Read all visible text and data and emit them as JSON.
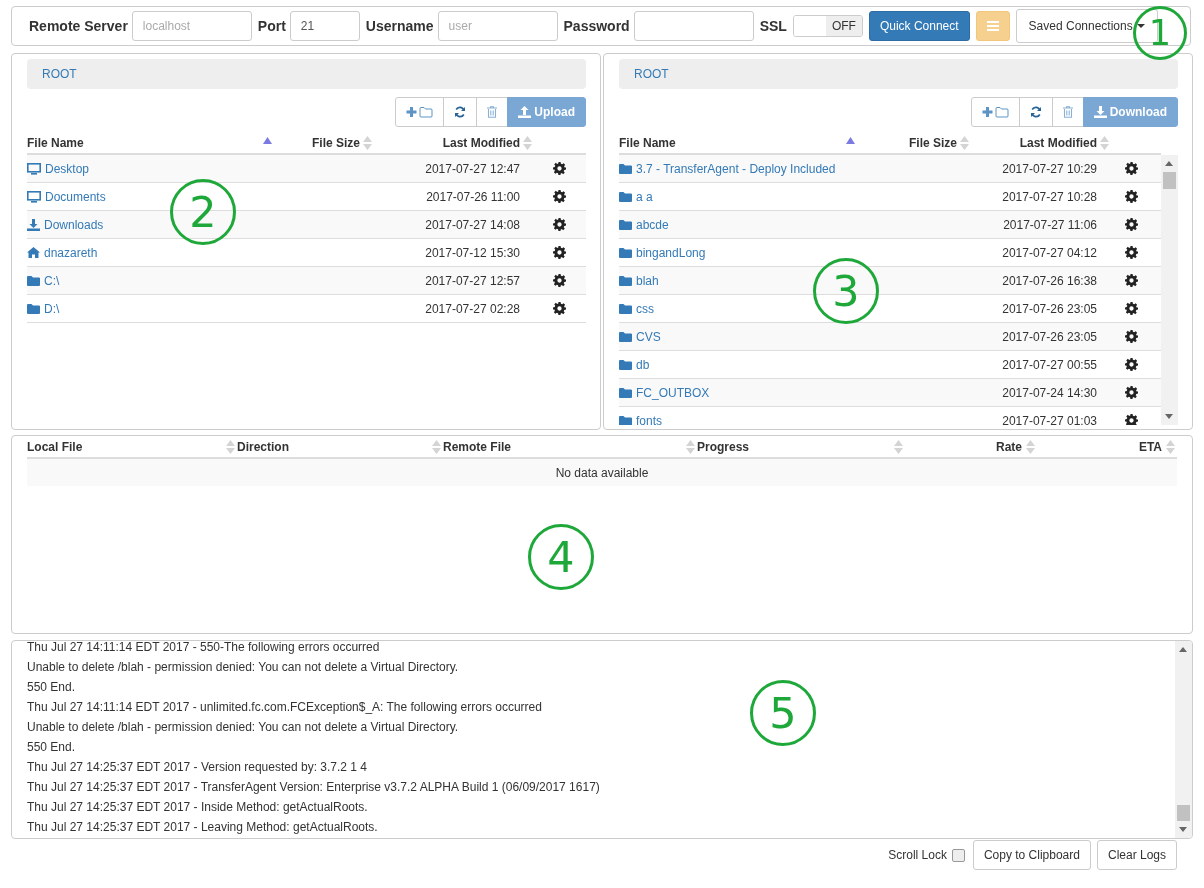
{
  "connect_bar": {
    "server": {
      "label": "Remote Server",
      "placeholder": "localhost"
    },
    "port": {
      "label": "Port",
      "value": "21"
    },
    "username": {
      "label": "Username",
      "placeholder": "user"
    },
    "password": {
      "label": "Password"
    },
    "ssl": {
      "label": "SSL",
      "state_text": "OFF",
      "on": false
    },
    "quick_connect": "Quick Connect",
    "saved_connections": "Saved Connections"
  },
  "local": {
    "path": "ROOT",
    "action": "Upload",
    "columns": [
      {
        "label": "File Name",
        "sorted": true
      },
      {
        "label": "File Size",
        "sorted": false
      },
      {
        "label": "Last Modified",
        "sorted": false
      }
    ],
    "rows": [
      {
        "name": "Desktop",
        "kind": "computer",
        "modified": "2017-07-27 12:47"
      },
      {
        "name": "Documents",
        "kind": "computer",
        "modified": "2017-07-26 11:00"
      },
      {
        "name": "Downloads",
        "kind": "download",
        "modified": "2017-07-27 14:08"
      },
      {
        "name": "dnazareth",
        "kind": "home",
        "modified": "2017-07-12 15:30"
      },
      {
        "name": "C:\\",
        "kind": "folder",
        "modified": "2017-07-27 12:57"
      },
      {
        "name": "D:\\",
        "kind": "folder",
        "modified": "2017-07-27 02:28"
      }
    ]
  },
  "remote": {
    "path": "ROOT",
    "action": "Download",
    "columns": [
      {
        "label": "File Name",
        "sorted": true
      },
      {
        "label": "File Size",
        "sorted": false
      },
      {
        "label": "Last Modified",
        "sorted": false
      }
    ],
    "rows": [
      {
        "name": "3.7 - TransferAgent - Deploy Included",
        "kind": "folder",
        "modified": "2017-07-27 10:29"
      },
      {
        "name": "a a",
        "kind": "folder",
        "modified": "2017-07-27 10:28"
      },
      {
        "name": "abcde",
        "kind": "folder",
        "modified": "2017-07-27 11:06"
      },
      {
        "name": "bingandLong",
        "kind": "folder",
        "modified": "2017-07-27 04:12"
      },
      {
        "name": "blah",
        "kind": "folder",
        "modified": "2017-07-26 16:38"
      },
      {
        "name": "css",
        "kind": "folder",
        "modified": "2017-07-26 23:05"
      },
      {
        "name": "CVS",
        "kind": "folder",
        "modified": "2017-07-26 23:05"
      },
      {
        "name": "db",
        "kind": "folder",
        "modified": "2017-07-27 00:55"
      },
      {
        "name": "FC_OUTBOX",
        "kind": "folder",
        "modified": "2017-07-24 14:30"
      },
      {
        "name": "fonts",
        "kind": "folder",
        "modified": "2017-07-27 01:03"
      }
    ]
  },
  "transfers": {
    "columns": [
      {
        "label": "Local File",
        "sorted": false
      },
      {
        "label": "Direction",
        "sorted": false
      },
      {
        "label": "Remote File",
        "sorted": false
      },
      {
        "label": "Progress",
        "sorted": false
      },
      {
        "label": "Rate",
        "sorted": false
      },
      {
        "label": "ETA",
        "sorted": false
      }
    ],
    "empty_text": "No data available"
  },
  "log": {
    "lines": [
      "Thu Jul 27 14:11:14 EDT 2017 - 550-The following errors occurred",
      "Unable to delete /blah - permission denied: You can not delete a Virtual Directory.",
      "550 End.",
      "Thu Jul 27 14:11:14 EDT 2017 - unlimited.fc.com.FCException$_A: The following errors occurred",
      "Unable to delete /blah - permission denied: You can not delete a Virtual Directory.",
      "550 End.",
      "Thu Jul 27 14:25:37 EDT 2017 - Version requested by: 3.7.2 1 4",
      "Thu Jul 27 14:25:37 EDT 2017 - TransferAgent Version: Enterprise v3.7.2 ALPHA Build 1 (06/09/2017 1617)",
      "Thu Jul 27 14:25:37 EDT 2017 - Inside Method: getActualRoots.",
      "Thu Jul 27 14:25:37 EDT 2017 - Leaving Method: getActualRoots."
    ],
    "scroll_lock": {
      "label": "Scroll Lock",
      "checked": false
    },
    "copy": "Copy to Clipboard",
    "clear": "Clear Logs"
  },
  "callouts": [
    {
      "label": "1"
    },
    {
      "label": "2"
    },
    {
      "label": "3"
    },
    {
      "label": "4"
    },
    {
      "label": "5"
    }
  ]
}
